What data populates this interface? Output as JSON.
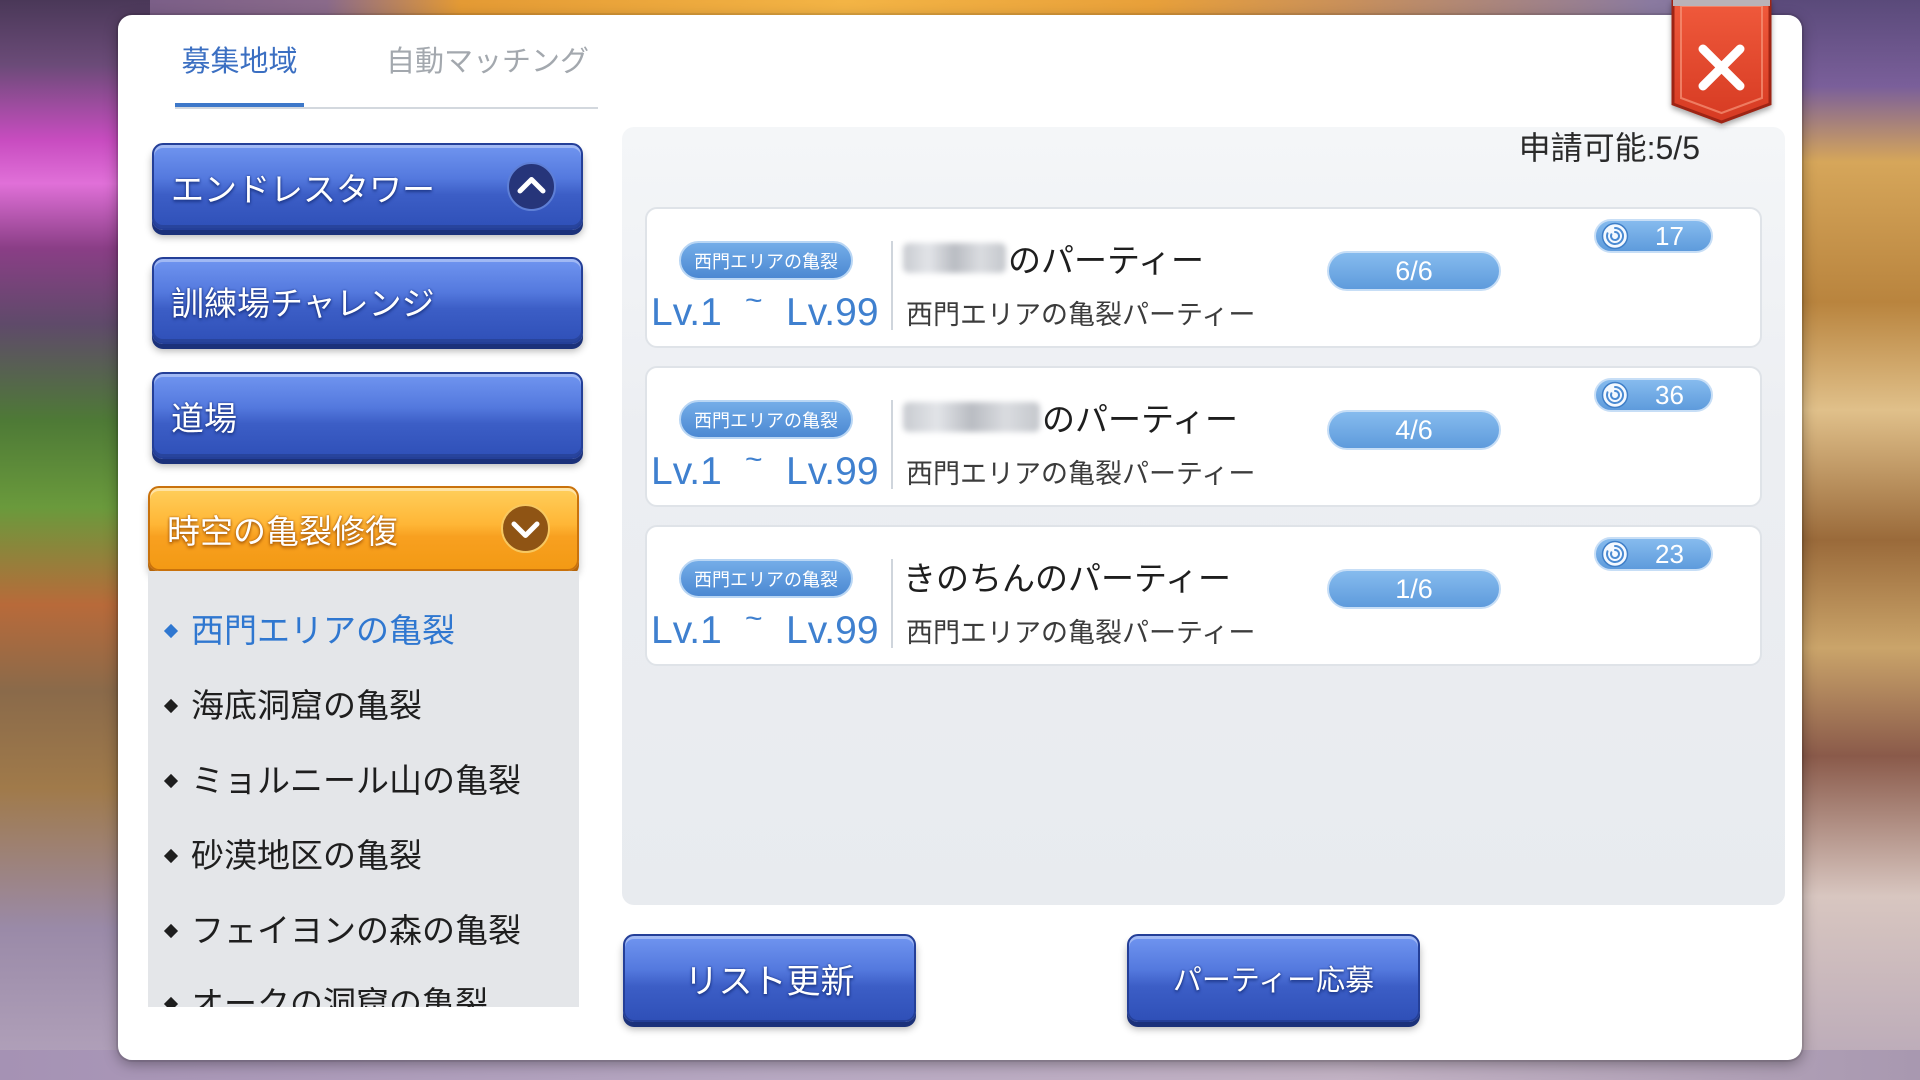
{
  "tabs": [
    {
      "label": "募集地域",
      "active": true
    },
    {
      "label": "自動マッチング",
      "active": false
    }
  ],
  "close_button": {
    "icon": "close-icon"
  },
  "categories": [
    {
      "label": "エンドレスタワー",
      "icon": "chevron-up-icon"
    },
    {
      "label": "訓練場チャレンジ"
    },
    {
      "label": "道場"
    },
    {
      "label": "時空の亀裂修復",
      "icon": "chevron-down-icon",
      "expanded": true
    }
  ],
  "subcategories": [
    {
      "label": "西門エリアの亀裂",
      "selected": true
    },
    {
      "label": "海底洞窟の亀裂",
      "selected": false
    },
    {
      "label": "ミョルニール山の亀裂",
      "selected": false
    },
    {
      "label": "砂漠地区の亀裂",
      "selected": false
    },
    {
      "label": "フェイヨンの森の亀裂",
      "selected": false
    },
    {
      "label": "オークの洞窟の亀裂",
      "selected": false
    }
  ],
  "application_limit": "申請可能:5/5",
  "parties": [
    {
      "region_tag": "西門エリアの亀裂",
      "level_min": "Lv.1",
      "level_separator": "~",
      "level_max": "Lv.99",
      "name": "のパーティー",
      "description": "西門エリアの亀裂パーティー",
      "members": "6/6",
      "score": "17",
      "score_icon": "orb-icon"
    },
    {
      "region_tag": "西門エリアの亀裂",
      "level_min": "Lv.1",
      "level_separator": "~",
      "level_max": "Lv.99",
      "name": "のパーティー",
      "description": "西門エリアの亀裂パーティー",
      "members": "4/6",
      "score": "36",
      "score_icon": "orb-icon"
    },
    {
      "region_tag": "西門エリアの亀裂",
      "level_min": "Lv.1",
      "level_separator": "~",
      "level_max": "Lv.99",
      "name": "きのちんのパーティー",
      "description": "西門エリアの亀裂パーティー",
      "members": "1/6",
      "score": "23",
      "score_icon": "orb-icon"
    }
  ],
  "buttons": {
    "refresh": "リスト更新",
    "apply": "パーティー応募"
  },
  "colors": {
    "accent": "#3d78c9",
    "button_blue_top": "#7095f0",
    "button_blue_bottom": "#2f50b8",
    "button_orange_top": "#ffcf5c",
    "button_orange_bottom": "#f39a14",
    "close_red": "#e4452a",
    "level_text": "#3f80cf",
    "selected_item": "#2f77d0",
    "pill_blue": "#5e9bdc"
  }
}
